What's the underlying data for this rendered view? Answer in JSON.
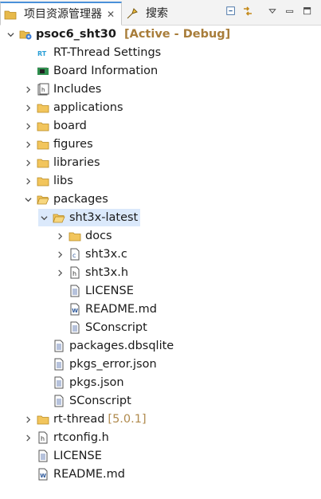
{
  "tabs": [
    {
      "label": "项目资源管理器",
      "close": "✕"
    },
    {
      "label": "搜索"
    }
  ],
  "project": {
    "name": "psoc6_sht30",
    "status": "[Active - Debug]"
  },
  "tree": {
    "rtthread_settings": "RT-Thread Settings",
    "board_information": "Board Information",
    "includes": "Includes",
    "applications": "applications",
    "board": "board",
    "figures": "figures",
    "libraries": "libraries",
    "libs": "libs",
    "packages": "packages",
    "sht3x_latest": "sht3x-latest",
    "docs": "docs",
    "sht3x_c": "sht3x.c",
    "sht3x_h": "sht3x.h",
    "license_inner": "LICENSE",
    "readme_inner": "README.md",
    "sconscript_inner": "SConscript",
    "packages_dbsqlite": "packages.dbsqlite",
    "pkgs_error": "pkgs_error.json",
    "pkgs_json": "pkgs.json",
    "sconscript_pkg": "SConscript",
    "rt_thread": "rt-thread",
    "rt_thread_version": "[5.0.1]",
    "rtconfig_h": "rtconfig.h",
    "license_root": "LICENSE",
    "readme_root": "README.md"
  },
  "colors": {
    "folder": "#e7b94a",
    "selection": "#dbe9fb",
    "status": "#a87d3a",
    "accent": "#4a90d9"
  }
}
